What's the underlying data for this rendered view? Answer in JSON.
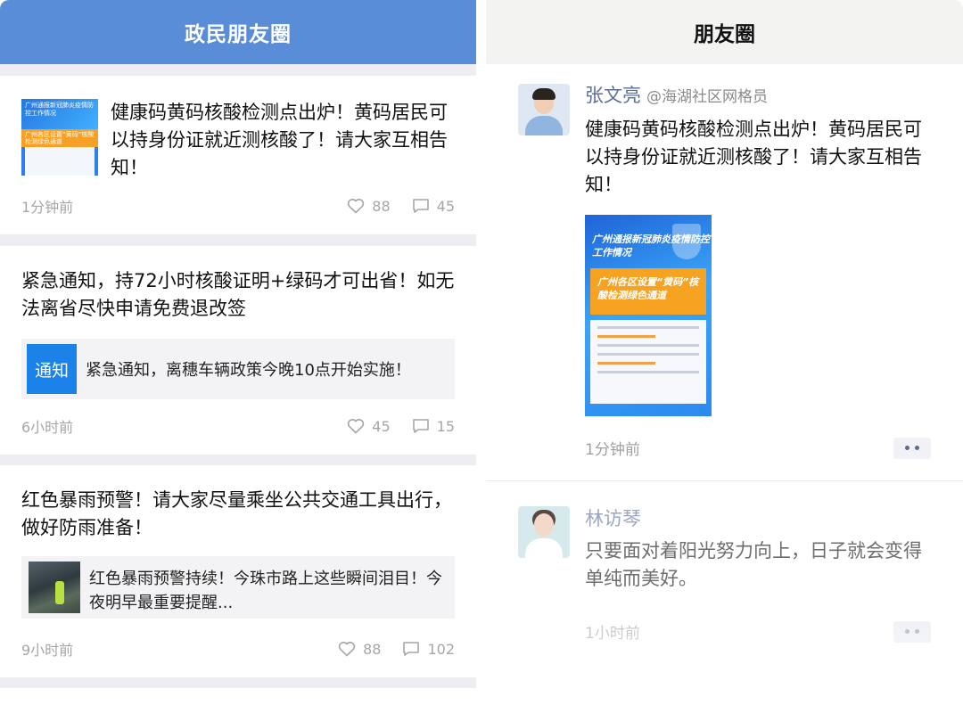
{
  "left": {
    "header_title": "政民朋友圈",
    "cards": [
      {
        "text": "健康码黄码核酸检测点出炉！黄码居民可以持身份证就近测核酸了！请大家互相告知！",
        "thumb_title": "广州通报新冠肺炎疫情防控工作情况",
        "thumb_sub": "广州各区设置“黄码”核酸检测绿色通道",
        "time": "1分钟前",
        "likes": "88",
        "comments": "45"
      },
      {
        "text": "紧急通知，持72小时核酸证明+绿码才可出省！如无法离省尽快申请免费退改签",
        "badge": "通知",
        "notice": "紧急通知，离穗车辆政策今晚10点开始实施！",
        "time": "6小时前",
        "likes": "45",
        "comments": "15"
      },
      {
        "text": "红色暴雨预警！请大家尽量乘坐公共交通工具出行，做好防雨准备！",
        "link_text": "红色暴雨预警持续！今珠市路上这些瞬间泪目！今夜明早最重要提醒...",
        "time": "9小时前",
        "likes": "88",
        "comments": "102"
      }
    ]
  },
  "right": {
    "header_title": "朋友圈",
    "posts": [
      {
        "name": "张文亮",
        "role": "@海湖社区网格员",
        "text": "健康码黄码核酸检测点出炉！黄码居民可以持身份证就近测核酸了！请大家互相告知！",
        "poster_title": "广州通报新冠肺炎疫情防控工作情况",
        "poster_sub": "广州各区设置“黄码”核酸检测绿色通道",
        "time": "1分钟前"
      },
      {
        "name": "林访琴",
        "text": "只要面对着阳光努力向上，日子就会变得单纯而美好。",
        "time": "1小时前"
      }
    ]
  },
  "colors": {
    "left_header": "#5a8dd8",
    "notice_badge": "#1a82e8",
    "username": "#5c6f96"
  },
  "icons": [
    "heart-icon",
    "comment-icon",
    "more-dots-icon"
  ]
}
